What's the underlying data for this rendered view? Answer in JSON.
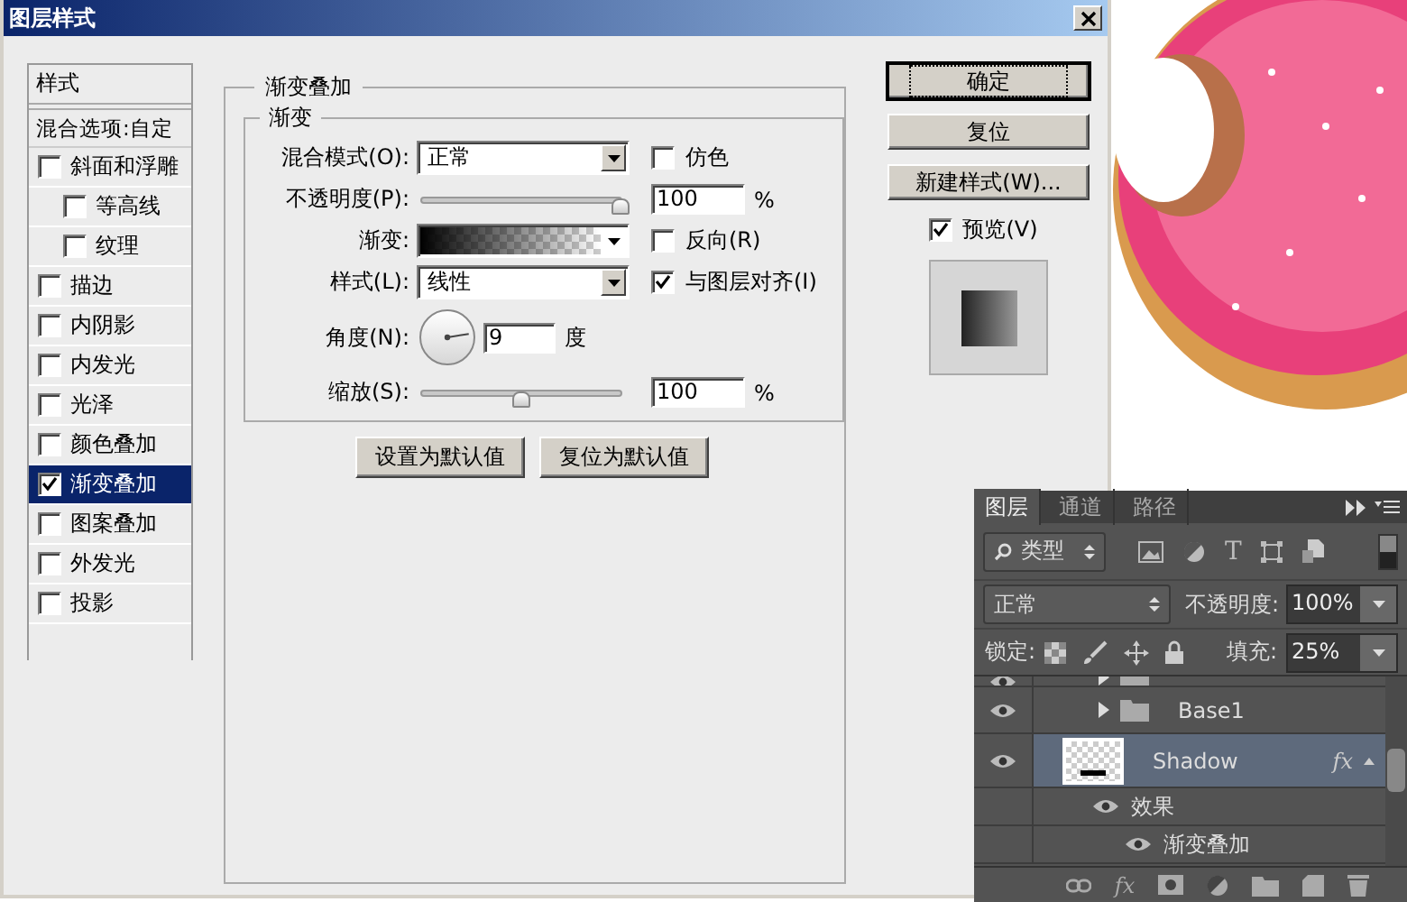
{
  "dialog": {
    "title": "图层样式"
  },
  "styles_list": {
    "header": "样式",
    "blending_options": "混合选项:自定",
    "items": [
      {
        "label": "斜面和浮雕",
        "checked": false,
        "selected": false,
        "children": [
          {
            "label": "等高线",
            "checked": false,
            "selected": false
          },
          {
            "label": "纹理",
            "checked": false,
            "selected": false
          }
        ]
      },
      {
        "label": "描边",
        "checked": false,
        "selected": false
      },
      {
        "label": "内阴影",
        "checked": false,
        "selected": false
      },
      {
        "label": "内发光",
        "checked": false,
        "selected": false
      },
      {
        "label": "光泽",
        "checked": false,
        "selected": false
      },
      {
        "label": "颜色叠加",
        "checked": false,
        "selected": false
      },
      {
        "label": "渐变叠加",
        "checked": true,
        "selected": true
      },
      {
        "label": "图案叠加",
        "checked": false,
        "selected": false
      },
      {
        "label": "外发光",
        "checked": false,
        "selected": false
      },
      {
        "label": "投影",
        "checked": false,
        "selected": false
      }
    ]
  },
  "gradient_overlay": {
    "title": "渐变叠加",
    "group_title": "渐变",
    "blend_mode": {
      "label": "混合模式(O):",
      "value": "正常"
    },
    "dither": {
      "label": "仿色",
      "checked": false
    },
    "opacity": {
      "label": "不透明度(P):",
      "level": 1,
      "value": "100",
      "unit": "%"
    },
    "gradient": {
      "label": "渐变:"
    },
    "reverse": {
      "label": "反向(R)",
      "checked": false
    },
    "style": {
      "label": "样式(L):",
      "value": "线性"
    },
    "align": {
      "label": "与图层对齐(I)",
      "checked": true
    },
    "angle": {
      "label": "角度(N):",
      "value": "9",
      "unit": "度"
    },
    "scale": {
      "label": "缩放(S):",
      "level": 0.5,
      "value": "100",
      "unit": "%"
    },
    "buttons": [
      "设置为默认值",
      "复位为默认值"
    ]
  },
  "actions": {
    "buttons": [
      {
        "label": "确定",
        "default": true
      },
      {
        "label": "复位",
        "default": false
      },
      {
        "label": "新建样式(W)...",
        "default": false
      }
    ],
    "preview": {
      "label": "预览(V)",
      "checked": true
    }
  },
  "layers_panel": {
    "tabs": [
      {
        "label": "图层",
        "selected": true
      },
      {
        "label": "通道",
        "selected": false
      },
      {
        "label": "路径",
        "selected": false
      }
    ],
    "filter": "类型",
    "filter_icons": [
      {
        "kind": "image"
      },
      {
        "kind": "adjust"
      },
      {
        "kind": "text",
        "label": "T"
      },
      {
        "kind": "shape"
      },
      {
        "kind": "smart"
      }
    ],
    "blend_mode": "正常",
    "opacity_label": "不透明度:",
    "opacity": "100%",
    "lock_label": "锁定:",
    "fill_label": "填充:",
    "fill": "25%",
    "layers": [
      {
        "kind": "group",
        "visible": true,
        "selected": false,
        "partial": true
      },
      {
        "kind": "group",
        "name": "Base1",
        "visible": true,
        "selected": false
      },
      {
        "kind": "layer",
        "name": "Shadow",
        "visible": true,
        "selected": true,
        "fx": "fx"
      },
      {
        "kind": "effects",
        "name": "效果",
        "visible": true,
        "selected": false
      },
      {
        "kind": "effect",
        "name": "渐变叠加",
        "visible": true,
        "selected": false
      }
    ],
    "footer": [
      {
        "kind": "link"
      },
      {
        "kind": "fx",
        "label": "fx"
      },
      {
        "kind": "mask"
      },
      {
        "kind": "adjust"
      },
      {
        "kind": "folder"
      },
      {
        "kind": "new"
      },
      {
        "kind": "trash"
      }
    ]
  }
}
